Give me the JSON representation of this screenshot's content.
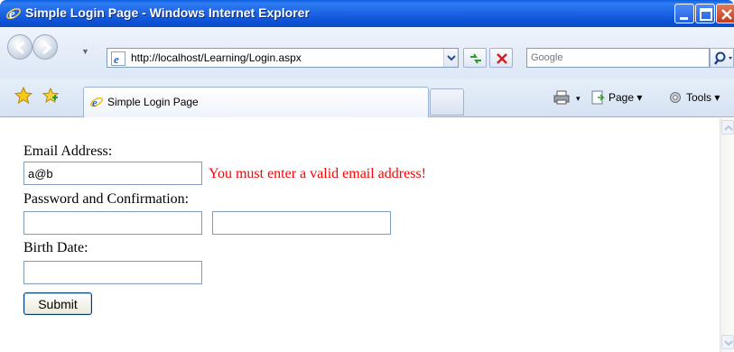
{
  "window": {
    "title": "Simple Login Page - Windows Internet Explorer"
  },
  "navigation": {
    "url": "http://localhost/Learning/Login.aspx",
    "search_placeholder": "Google"
  },
  "tabs": [
    {
      "label": "Simple Login Page",
      "active": true
    }
  ],
  "command_bar": {
    "page_label": "Page ▾",
    "tools_label": "Tools ▾",
    "print_dropdown": "▾"
  },
  "form": {
    "email_label": "Email Address:",
    "email_value": "a@b",
    "email_error": "You must enter a valid email address!",
    "password_label": "Password and Confirmation:",
    "password_value": "",
    "confirm_value": "",
    "birth_label": "Birth Date:",
    "birth_value": "",
    "submit_label": "Submit"
  },
  "colors": {
    "error": "#ff0000",
    "titlebar": "#0d52d6",
    "field_border": "#7f9db9"
  }
}
